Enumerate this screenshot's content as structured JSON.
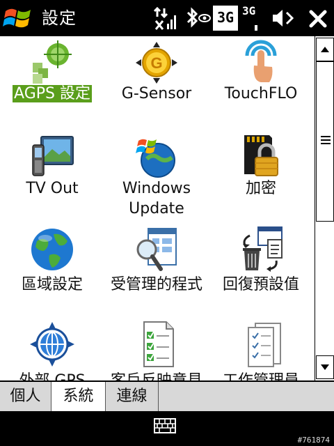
{
  "titlebar": {
    "title": "設定",
    "network_3g": "3G",
    "network_3g_small": "3G"
  },
  "tiles": [
    {
      "label": "AGPS 設定",
      "icon": "agps-satellite-icon",
      "selected": true
    },
    {
      "label": "G-Sensor",
      "icon": "g-sensor-icon"
    },
    {
      "label": "TouchFLO",
      "icon": "touchflo-icon"
    },
    {
      "label": "TV Out",
      "icon": "tv-out-icon"
    },
    {
      "label": "Windows",
      "label2": "Update",
      "icon": "windows-update-icon"
    },
    {
      "label": "加密",
      "icon": "encryption-lock-icon"
    },
    {
      "label": "區域設定",
      "icon": "globe-icon"
    },
    {
      "label": "受管理的程式",
      "icon": "managed-programs-icon"
    },
    {
      "label": "回復預設值",
      "icon": "reset-defaults-icon"
    },
    {
      "label": "外部 GPS",
      "icon": "external-gps-icon"
    },
    {
      "label": "客戶反映意見",
      "icon": "feedback-checklist-icon"
    },
    {
      "label": "工作管理員",
      "icon": "task-manager-icon"
    }
  ],
  "tabs": [
    {
      "label": "個人",
      "active": false
    },
    {
      "label": "系統",
      "active": true
    },
    {
      "label": "連線",
      "active": false
    }
  ],
  "watermark": "#761874"
}
